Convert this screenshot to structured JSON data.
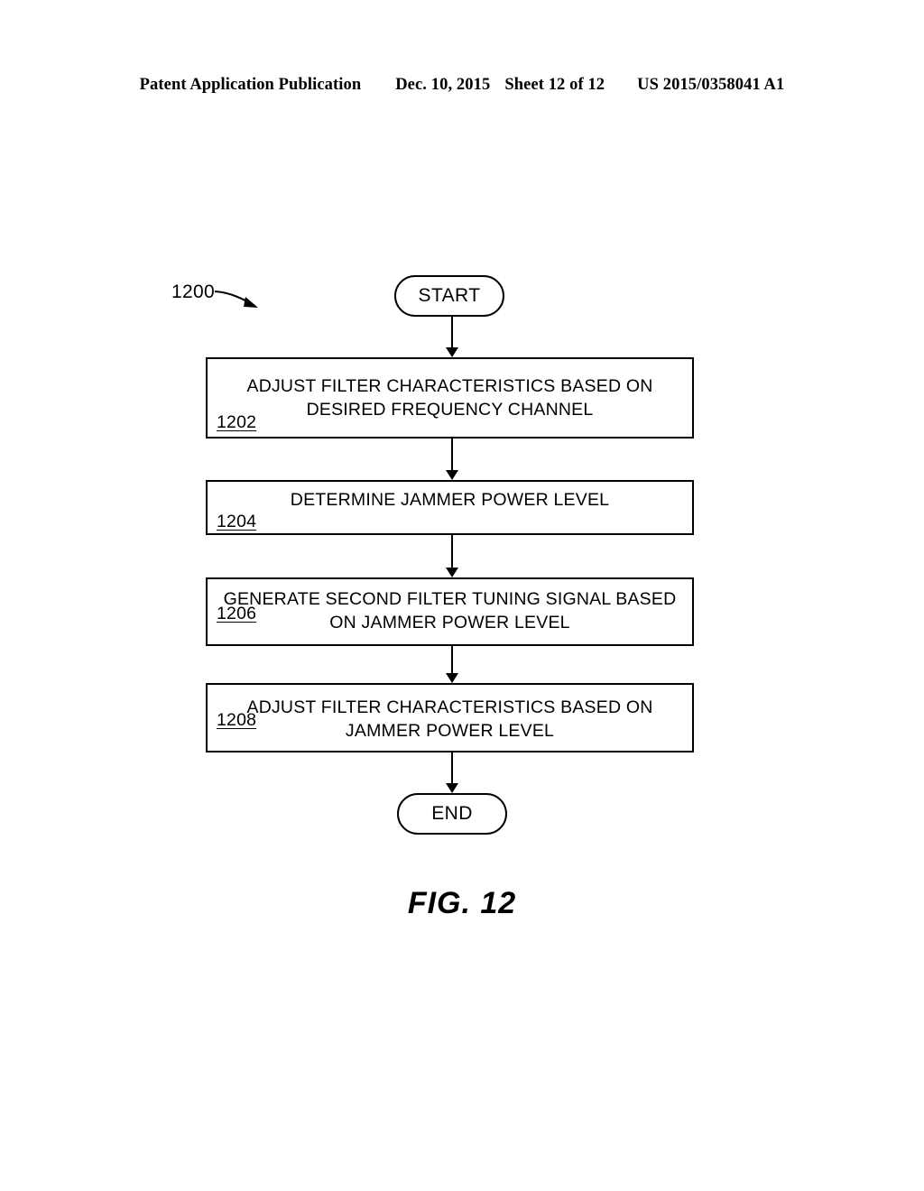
{
  "header": {
    "publication": "Patent Application Publication",
    "date": "Dec. 10, 2015",
    "sheet": "Sheet 12 of 12",
    "patent_number": "US 2015/0358041 A1"
  },
  "figure": {
    "reference_number": "1200",
    "caption": "FIG. 12",
    "nodes": {
      "start": "START",
      "end": "END"
    },
    "steps": [
      {
        "ref": "1202",
        "text": "ADJUST FILTER CHARACTERISTICS BASED ON\nDESIRED FREQUENCY CHANNEL"
      },
      {
        "ref": "1204",
        "text": "DETERMINE JAMMER POWER LEVEL"
      },
      {
        "ref": "1206",
        "text": "GENERATE SECOND FILTER TUNING SIGNAL BASED\nON JAMMER POWER LEVEL"
      },
      {
        "ref": "1208",
        "text": "ADJUST FILTER CHARACTERISTICS BASED ON\nJAMMER POWER LEVEL"
      }
    ]
  },
  "colors": {
    "ink": "#000000",
    "page": "#ffffff"
  }
}
